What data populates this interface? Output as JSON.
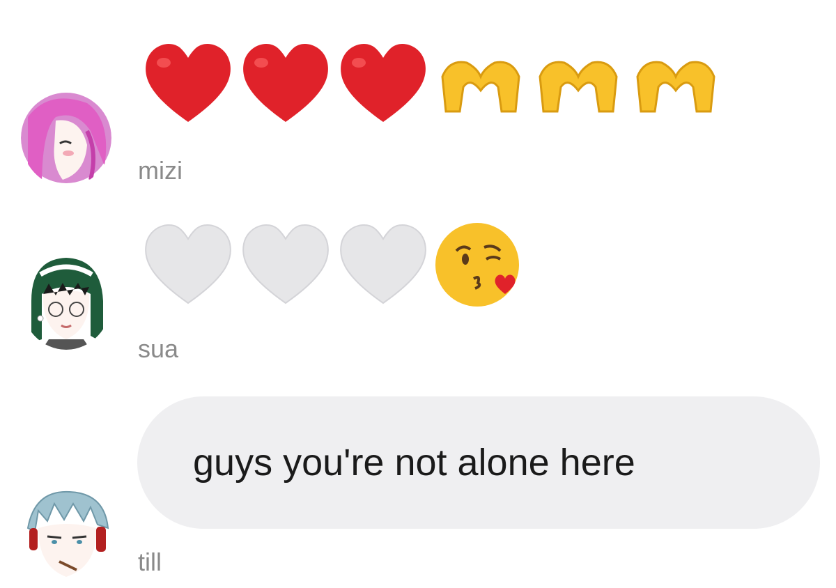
{
  "messages": [
    {
      "username": "mizi",
      "avatar_icon": "pink-hair-anime-avatar",
      "emojis": [
        "red-heart",
        "red-heart",
        "red-heart",
        "heart-hands",
        "heart-hands",
        "heart-hands"
      ]
    },
    {
      "username": "sua",
      "avatar_icon": "green-hair-glasses-anime-avatar",
      "emojis": [
        "white-heart",
        "white-heart",
        "white-heart",
        "face-blowing-kiss"
      ]
    },
    {
      "username": "till",
      "avatar_icon": "silver-hair-headphones-anime-avatar",
      "text": "guys you're not alone here"
    }
  ],
  "colors": {
    "bubble_bg": "#efeff1",
    "username": "#8a8a8a",
    "red_heart": "#e0222a",
    "white_heart": "#e6e6e8",
    "emoji_yellow": "#f8c12a"
  }
}
